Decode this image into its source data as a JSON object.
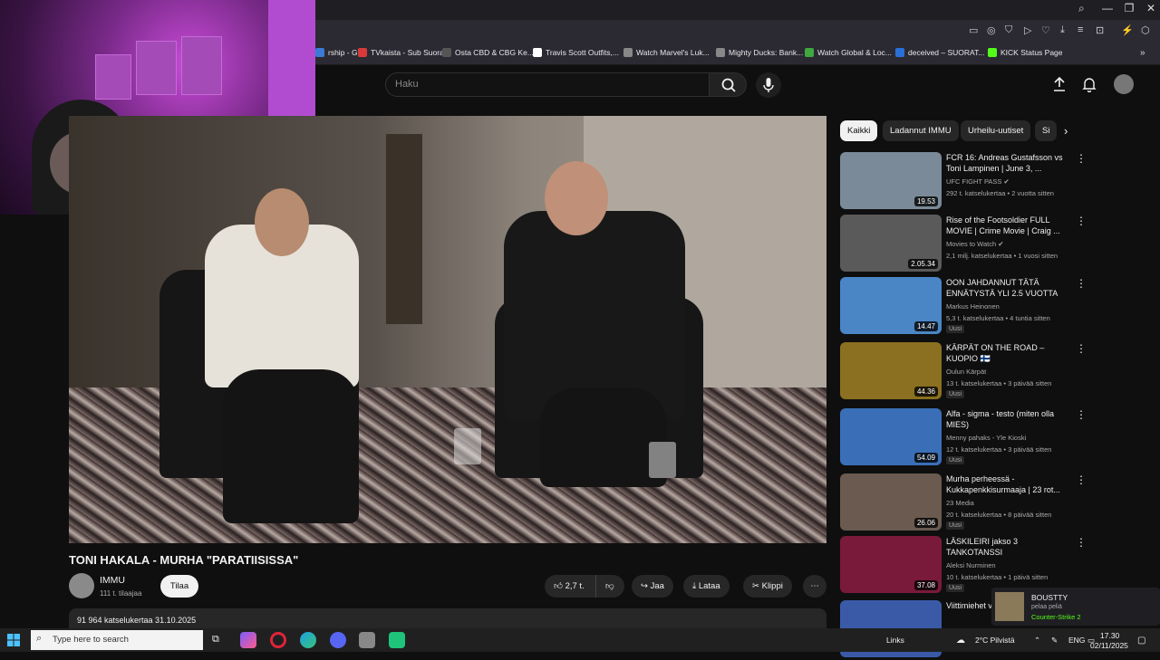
{
  "window": {
    "minimize": "—",
    "maximize": "❐",
    "close": "✕"
  },
  "bookmarks": [
    {
      "label": "rship - G...",
      "color": "#3a7bd5"
    },
    {
      "label": "TVkaista - Sub Suora",
      "color": "#d83a3a"
    },
    {
      "label": "Osta CBD & CBG Ke...",
      "color": "#555555"
    },
    {
      "label": "Travis Scott Outfits,...",
      "color": "#ffffff"
    },
    {
      "label": "Watch Marvel's Luk...",
      "color": "#888888"
    },
    {
      "label": "Mighty Ducks: Bank...",
      "color": "#888888"
    },
    {
      "label": "Watch Global & Loc...",
      "color": "#3fa83f"
    },
    {
      "label": "deceived – SUORAT...",
      "color": "#2a6fd8"
    },
    {
      "label": "KICK Status Page",
      "color": "#53fc18"
    }
  ],
  "search": {
    "placeholder": "Haku"
  },
  "video": {
    "title": "TONI HAKALA - MURHA \"PARATIISISSA\"",
    "channel": "IMMU",
    "subscribers": "111 t. tilaajaa",
    "subscribe_label": "Tilaa",
    "likes": "2,7 t.",
    "share_label": "Jaa",
    "download_label": "Lataa",
    "clip_label": "Klippi",
    "views_date": "91 964 katselukertaa  31.10.2025"
  },
  "chips": [
    {
      "label": "Kaikki",
      "active": true
    },
    {
      "label": "Ladannut IMMU",
      "active": false
    },
    {
      "label": "Urheilu-uutiset",
      "active": false
    },
    {
      "label": "Si",
      "active": false
    }
  ],
  "recommendations": [
    {
      "title": "FCR 16: Andreas Gustafsson vs Toni Lampinen | June 3, ...",
      "channel": "UFC FIGHT PASS ✔",
      "stats": "292 t. katselukertaa • 2 vuotta sitten",
      "duration": "19.53",
      "badge": "",
      "thumb": "#7a8a98"
    },
    {
      "title": "Rise of the Footsoldier FULL MOVIE | Crime Movie | Craig ...",
      "channel": "Movies to Watch ✔",
      "stats": "2,1 milj. katselukertaa • 1 vuosi sitten",
      "duration": "2.05.34",
      "badge": "",
      "thumb": "#5a5a5a"
    },
    {
      "title": "OON JAHDANNUT TÄTÄ ENNÄTYSTÄ YLI 2.5 VUOTTA",
      "channel": "Markus Heinonen",
      "stats": "5,3 t. katselukertaa • 4 tuntia sitten",
      "duration": "14.47",
      "badge": "Uusi",
      "thumb": "#4a86c6"
    },
    {
      "title": "KÄRPÄT ON THE ROAD – KUOPIO 🇫🇮",
      "channel": "Oulun Kärpät",
      "stats": "13 t. katselukertaa • 3 päivää sitten",
      "duration": "44.36",
      "badge": "Uusi",
      "thumb": "#8a7020"
    },
    {
      "title": "Alfa - sigma - testo (miten olla MIES)",
      "channel": "Menny pahaks - Yle Kioski",
      "stats": "12 t. katselukertaa • 3 päivää sitten",
      "duration": "54.09",
      "badge": "Uusi",
      "thumb": "#3a6fb8"
    },
    {
      "title": "Murha perheessä - Kukkapenkkisurmaaja | 23 rot...",
      "channel": "23 Media",
      "stats": "20 t. katselukertaa • 8 päivää sitten",
      "duration": "26.06",
      "badge": "Uusi",
      "thumb": "#6a5a50"
    },
    {
      "title": "LÄSKILEIRI jakso 3 TANKOTANSSI",
      "channel": "Aleksi Nurminen",
      "stats": "10 t. katselukertaa • 1 päivä sitten",
      "duration": "37.08",
      "badge": "Uusi",
      "thumb": "#7a1a3a"
    },
    {
      "title": "Viittimiehet vartaassa",
      "channel": "",
      "stats": "",
      "duration": "",
      "badge": "",
      "thumb": "#3a5aa8"
    }
  ],
  "toast": {
    "title": "BOUSTTY",
    "subtitle": "pelaa peliä",
    "game": "Counter-Strike 2"
  },
  "taskbar": {
    "search_placeholder": "Type here to search",
    "links": "Links",
    "weather": "2°C  Pilvistä",
    "lang": "ENG",
    "time": "17.30",
    "date": "02/11/2025"
  }
}
